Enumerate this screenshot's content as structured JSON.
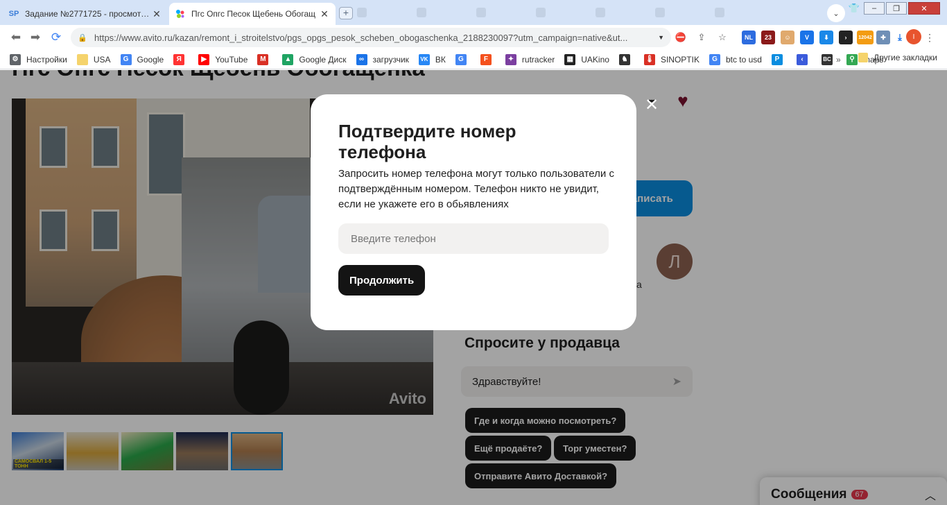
{
  "browser": {
    "tabs": [
      {
        "favicon": "SP",
        "title": "Задание №2771725 - просмотр з",
        "close": "✕"
      },
      {
        "favicon": "avito-icon",
        "title": "Пгс Опгс Песок Щебень Обогащ",
        "close": "✕"
      }
    ],
    "new_tab": "+",
    "url": "https://www.avito.ru/kazan/remont_i_stroitelstvo/pgs_opgs_pesok_scheben_obogaschenka_2188230097?utm_campaign=native&ut...",
    "ext_badge_nl": "NL",
    "ext_badge_23": "23",
    "ext_badge_btc": "12042",
    "profile_initial": "I"
  },
  "bookmarks": {
    "items": [
      {
        "label": "Настройки",
        "icon": "gear-icon",
        "color": "#5f6368"
      },
      {
        "label": "USA",
        "icon": "folder-icon",
        "color": "#f5d36c"
      },
      {
        "label": "Google",
        "icon": "google-icon",
        "color": "#4285f4"
      },
      {
        "label": "",
        "icon": "yandex-icon",
        "color": "#ff3333"
      },
      {
        "label": "YouTube",
        "icon": "youtube-icon",
        "color": "#ff0000"
      },
      {
        "label": "",
        "icon": "gmail-icon",
        "color": "#d93025"
      },
      {
        "label": "Google Диск",
        "icon": "drive-icon",
        "color": "#1fa463"
      },
      {
        "label": "загрузчик",
        "icon": "infinity-icon",
        "color": "#1a73e8"
      },
      {
        "label": "ВК",
        "icon": "vk-icon",
        "color": "#2787f5"
      },
      {
        "label": "",
        "icon": "translate-icon",
        "color": "#4285f4"
      },
      {
        "label": "",
        "icon": "f-icon",
        "color": "#f4511e"
      },
      {
        "label": "rutracker",
        "icon": "rutracker-icon",
        "color": "#7b3fa0"
      },
      {
        "label": "UAKino",
        "icon": "uakino-icon",
        "color": "#222222"
      },
      {
        "label": "",
        "icon": "chess-icon",
        "color": "#333333"
      },
      {
        "label": "SINOPTIK",
        "icon": "thermometer-icon",
        "color": "#d93025"
      },
      {
        "label": "btc to usd",
        "icon": "google-icon",
        "color": "#4285f4"
      },
      {
        "label": "",
        "icon": "p-icon",
        "color": "#0a8de0"
      },
      {
        "label": "",
        "icon": "arrow-left-icon",
        "color": "#3b5bdb"
      },
      {
        "label": "",
        "icon": "bc-icon",
        "color": "#333333"
      },
      {
        "label": "maps",
        "icon": "maps-icon",
        "color": "#34a853"
      }
    ],
    "more": "»",
    "other": "Другие закладки"
  },
  "page": {
    "title": "Пгс Опгс Песок Щебень Обогащенка",
    "watermark": "Avito",
    "thumb_caption": "САМОСВАЛ 1-5 ТОНН",
    "call_button": "Написать",
    "seller_initial": "Л",
    "seller_fragment": "а",
    "ask": {
      "title": "Спросите у продавца",
      "input_value": "Здравствуйте!",
      "chips": [
        "Где и когда можно посмотреть?",
        "Ещё продаёте?",
        "Торг уместен?",
        "Отправите Авито Доставкой?"
      ]
    },
    "messages": {
      "label": "Сообщения",
      "count": "67"
    }
  },
  "modal": {
    "close": "✕",
    "title": "Подтвердите номер телефона",
    "text": "Запросить номер телефона могут только пользователи с подтверждённым номером. Телефон никто не увидит, если не укажете его в обьявлениях",
    "phone_placeholder": "Введите телефон",
    "continue_label": "Продолжить"
  },
  "colors": {
    "accent_blue": "#0a8de0",
    "favorite_red": "#7a1230",
    "button_dark": "#141414",
    "badge_red": "#e8384e"
  }
}
